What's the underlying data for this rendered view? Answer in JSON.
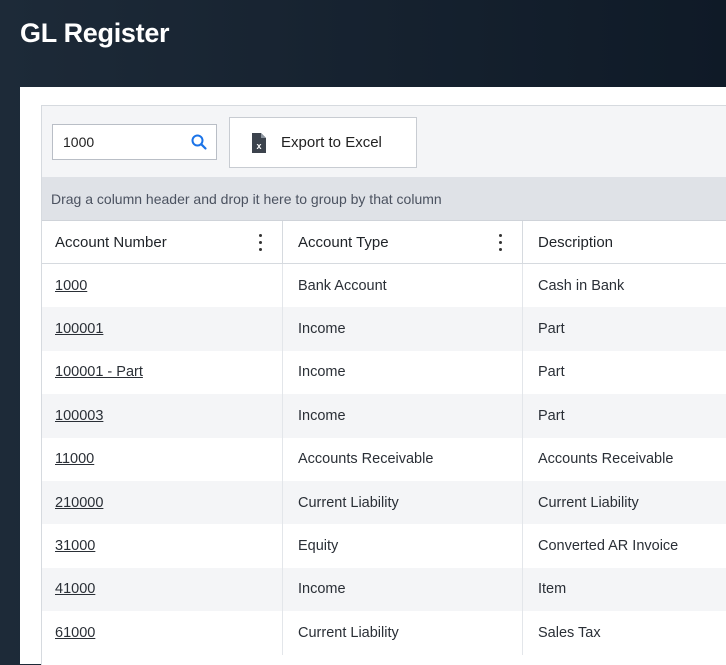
{
  "page": {
    "title": "GL Register"
  },
  "toolbar": {
    "search_value": "1000",
    "export_label": "Export to Excel"
  },
  "group_bar": {
    "text": "Drag a column header and drop it here to group by that column"
  },
  "columns": [
    {
      "label": "Account Number"
    },
    {
      "label": "Account Type"
    },
    {
      "label": "Description"
    }
  ],
  "rows": [
    {
      "account": "1000",
      "type": "Bank Account",
      "description": "Cash in Bank"
    },
    {
      "account": "100001",
      "type": "Income",
      "description": "Part"
    },
    {
      "account": "100001 - Part",
      "type": "Income",
      "description": "Part"
    },
    {
      "account": "100003",
      "type": "Income",
      "description": "Part"
    },
    {
      "account": "11000",
      "type": "Accounts Receivable",
      "description": "Accounts Receivable"
    },
    {
      "account": "210000",
      "type": "Current Liability",
      "description": "Current Liability"
    },
    {
      "account": "31000",
      "type": "Equity",
      "description": "Converted AR Invoice"
    },
    {
      "account": "41000",
      "type": "Income",
      "description": "Item"
    },
    {
      "account": "61000",
      "type": "Current Liability",
      "description": "Sales Tax"
    }
  ],
  "colors": {
    "accent": "#1a73e8",
    "header_bg": "#132130"
  }
}
